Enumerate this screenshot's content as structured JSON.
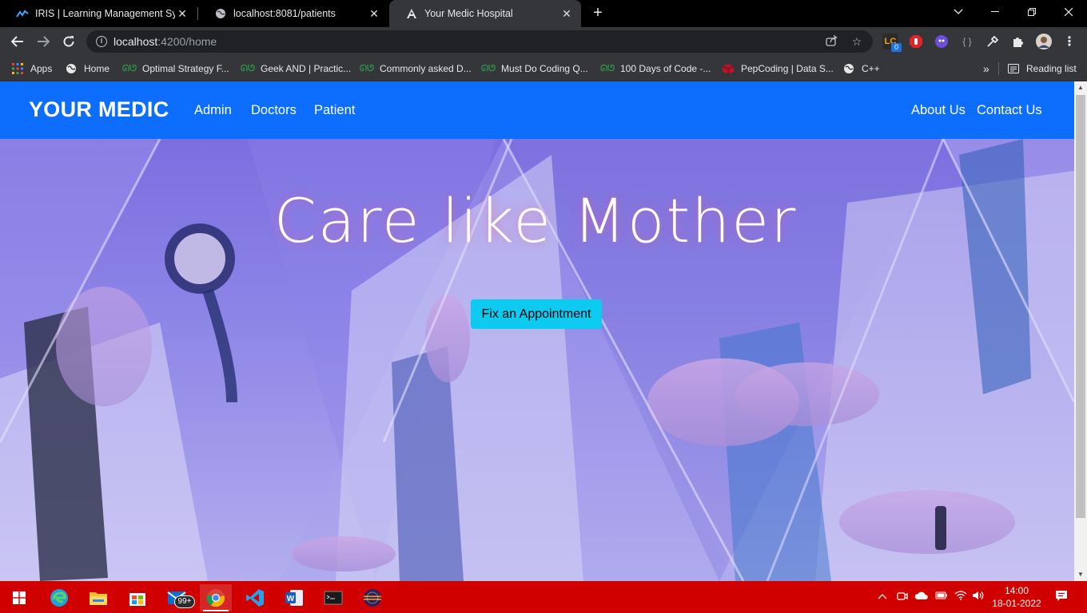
{
  "browser": {
    "tabs": [
      {
        "title": "IRIS | Learning Management Syst",
        "icon": "iris-icon",
        "active": false
      },
      {
        "title": "localhost:8081/patients",
        "icon": "globe-icon",
        "active": false
      },
      {
        "title": "Your Medic Hospital",
        "icon": "angular-icon",
        "active": true
      }
    ],
    "new_tab": "+",
    "address": {
      "host": "localhost",
      "path": ":4200/home"
    },
    "extension_badge": "0",
    "bookmarks": [
      {
        "label": "Apps",
        "icon": "apps-grid-icon"
      },
      {
        "label": "Home",
        "icon": "globe-icon"
      },
      {
        "label": "Optimal Strategy F...",
        "icon": "gfg-icon"
      },
      {
        "label": "Geek AND | Practic...",
        "icon": "gfg-icon"
      },
      {
        "label": "Commonly asked D...",
        "icon": "gfg-icon"
      },
      {
        "label": "Must Do Coding Q...",
        "icon": "gfg-icon"
      },
      {
        "label": "100 Days of Code -...",
        "icon": "gfg-icon"
      },
      {
        "label": "PepCoding | Data S...",
        "icon": "pepcoding-icon"
      },
      {
        "label": "C++",
        "icon": "globe-icon"
      }
    ],
    "more_bookmarks": "»",
    "reading_list": "Reading list"
  },
  "page": {
    "brand": "YOUR MEDIC",
    "nav_left": [
      "Admin",
      "Doctors",
      "Patient"
    ],
    "nav_right": [
      "About Us",
      "Contact Us"
    ],
    "hero_title": "Care like Mother",
    "cta_label": "Fix an Appointment"
  },
  "taskbar": {
    "mail_badge": "99+",
    "time": "14:00",
    "date": "18-01-2022"
  },
  "colors": {
    "navbar": "#0d6efd",
    "cta": "#0dcaf0",
    "taskbar": "#d10000",
    "hero_overlay": "#8a82e6"
  }
}
